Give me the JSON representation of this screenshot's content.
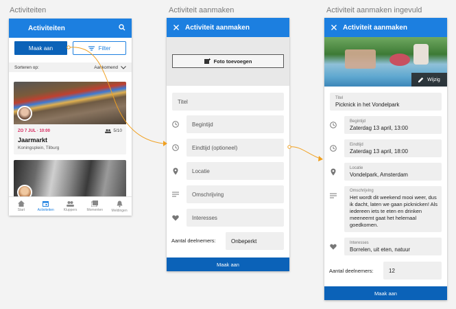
{
  "titles": [
    "Activiteiten",
    "Activiteit aanmaken",
    "Activiteit aanmaken ingevuld"
  ],
  "screen1": {
    "appbar_title": "Activiteiten",
    "create_label": "Maak aan",
    "filter_label": "Filter",
    "sort_label": "Sorteren op:",
    "sort_value": "Aankomend",
    "cards": [
      {
        "date": "ZO 7 JUL · 10:00",
        "count": "5/10",
        "title": "Jaarmarkt",
        "location": "Koningsplein, Tilburg"
      }
    ],
    "nav": [
      {
        "label": "Start",
        "icon": "home-icon"
      },
      {
        "label": "Activiteiten",
        "icon": "calendar-icon"
      },
      {
        "label": "Kluppers",
        "icon": "people-icon"
      },
      {
        "label": "Momenten",
        "icon": "photos-icon"
      },
      {
        "label": "Meldingen",
        "icon": "bell-icon"
      }
    ]
  },
  "screen2": {
    "appbar_title": "Activiteit aanmaken",
    "photo_label": "Foto toevoegen",
    "title_placeholder": "Titel",
    "start_placeholder": "Begintijd",
    "end_placeholder": "Eindtijd (optioneel)",
    "location_placeholder": "Locatie",
    "description_placeholder": "Omschrijving",
    "interests_placeholder": "Interesses",
    "participants_label": "Aantal deelnemers:",
    "participants_value": "Onbeperkt",
    "submit_label": "Maak aan"
  },
  "screen3": {
    "appbar_title": "Activiteit aanmaken",
    "edit_label": "Wijzig",
    "title_label": "Titel",
    "title_value": "Picknick in het Vondelpark",
    "start_label": "Begintijd",
    "start_value": "Zaterdag 13 april, 13:00",
    "end_label": "Eindtijd",
    "end_value": "Zaterdag 13 april, 18:00",
    "location_label": "Locatie",
    "location_value": "Vondelpark, Amsterdam",
    "description_label": "Omschrijving",
    "description_value": "Het wordt dit weekend mooi weer, dus ik dacht, laten we gaan picknicken! Als iedereen iets te eten en drinken meeneemt gaat het helemaal goedkomen.",
    "interests_label": "Interesses",
    "interests_value": "Borrelen, uit eten, natuur",
    "participants_label": "Aantal deelnemers:",
    "participants_value": "12",
    "submit_label": "Maak aan"
  },
  "colors": {
    "primary": "#1c7fe0",
    "dark_primary": "#0b62b8",
    "accent_date": "#d6245a",
    "arrow": "#f0a020"
  }
}
